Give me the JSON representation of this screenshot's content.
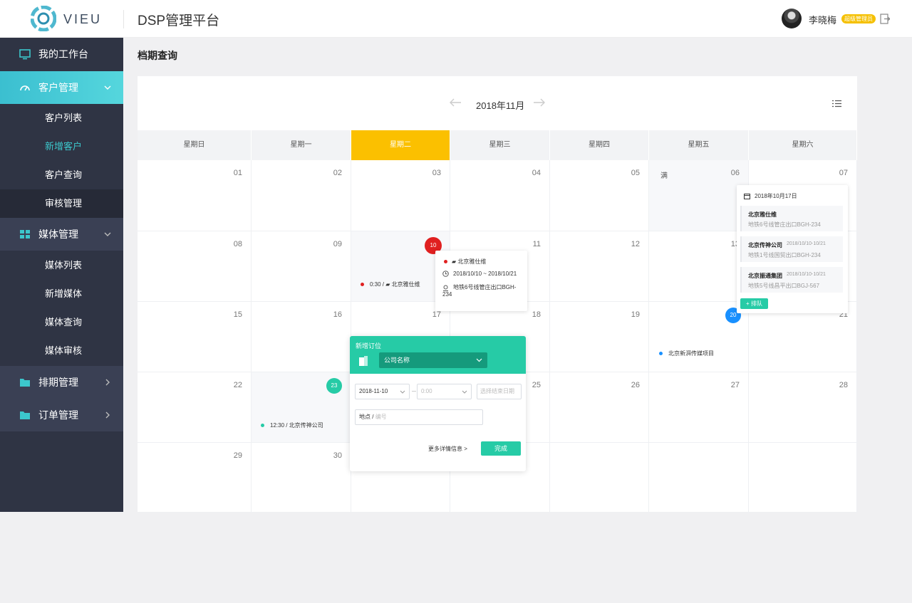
{
  "header": {
    "logo_text": "VIEU",
    "app_title": "DSP管理平台",
    "user_name": "李晓梅",
    "role_badge": "超级管理员"
  },
  "sidebar": {
    "items": [
      {
        "label": "我的工作台",
        "icon": "monitor-icon"
      },
      {
        "label": "客户管理",
        "icon": "gauge-icon",
        "active": true
      },
      {
        "label": "媒体管理",
        "icon": "grid-icon"
      },
      {
        "label": "排期管理",
        "icon": "folder-icon"
      },
      {
        "label": "订单管理",
        "icon": "folder-icon"
      }
    ],
    "customer_sub": [
      "客户列表",
      "新增客户",
      "客户查询",
      "审核管理"
    ],
    "media_sub": [
      "媒体列表",
      "新增媒体",
      "媒体查询",
      "媒体审核"
    ]
  },
  "page": {
    "title": "档期查询"
  },
  "calendar": {
    "month_label": "2018年11月",
    "weekdays": [
      "星期日",
      "星期一",
      "星期二",
      "星期三",
      "星期四",
      "星期五",
      "星期六"
    ],
    "today_weekday_index": 2,
    "weeks": [
      [
        "01",
        "02",
        "03",
        "04",
        "05",
        "06",
        "07"
      ],
      [
        "08",
        "09",
        "10",
        "11",
        "12",
        "13",
        ""
      ],
      [
        "15",
        "16",
        "17",
        "18",
        "19",
        "20",
        "21"
      ],
      [
        "22",
        "23",
        "",
        "25",
        "26",
        "27",
        "28"
      ],
      [
        "29",
        "30",
        "",
        "",
        "",
        "",
        ""
      ]
    ],
    "full_label": "满",
    "events": {
      "nov10": {
        "time": "0:30",
        "name": "北京雅仕维"
      },
      "nov20": {
        "name": "北京新湃传媒项目"
      },
      "nov23": {
        "text": "12:30 / 北京传神公司"
      }
    },
    "circles": {
      "nov10": "10",
      "nov20": "20",
      "nov23": "23"
    }
  },
  "popup_detail": {
    "name": "北京雅仕维",
    "date_range": "2018/10/10 ~ 2018/10/21",
    "address": "地铁6号线管庄出口BGH-234"
  },
  "popup_schedule": {
    "date": "2018年10月17日",
    "items": [
      {
        "name": "北京雅仕维",
        "date": "",
        "address": "地铁6号线管庄出口BGH-234"
      },
      {
        "name": "北京传神公司",
        "date": "2018/10/10-10/21",
        "address": "地铁1号线国贸出口BGH-234"
      },
      {
        "name": "北京振通集团",
        "date": "2018/10/10-10/21",
        "address": "地铁5号线昌平出口BGJ-567"
      }
    ],
    "add_button": "+ 排队"
  },
  "form": {
    "title": "新增订位",
    "company_placeholder": "公司名称",
    "start_date": "2018-11-10",
    "start_time": "0:00",
    "end_date_placeholder": "选择结束日期",
    "location_label": "地点 /",
    "location_placeholder": "编号",
    "more_link": "更多详情信息 >",
    "done_button": "完成"
  },
  "colors": {
    "accent": "#26cba6",
    "today": "#fbc000",
    "sidebar_bg": "#2f3444",
    "red": "#e02020",
    "blue": "#1890ff"
  }
}
